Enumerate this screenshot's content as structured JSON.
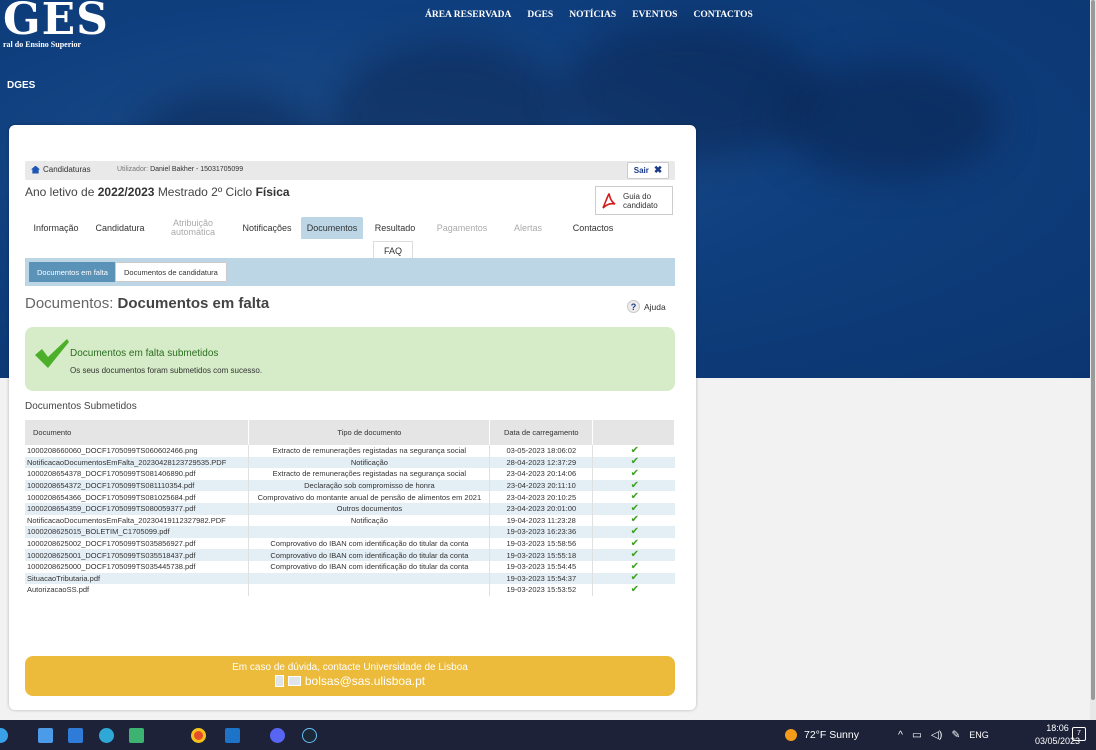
{
  "site": {
    "logo": "GES",
    "logo_sub": "ral do Ensino Superior",
    "section": "DGES",
    "nav": [
      "ÁREA RESERVADA",
      "DGES",
      "NOTÍCIAS",
      "EVENTOS",
      "CONTACTOS"
    ]
  },
  "userbar": {
    "home_label": "Candidaturas",
    "user_prefix": "Utilizador:",
    "user_name": "Daniel Bakher - 15031705099",
    "logout": "Sair"
  },
  "header": {
    "year_prefix": "Ano letivo de",
    "year": "2022/2023",
    "degree": "Mestrado 2º Ciclo",
    "course": "Física",
    "guide_line1": "Guia do",
    "guide_line2": "candidato"
  },
  "tabs": {
    "info": "Informação",
    "candidatura": "Candidatura",
    "atribuicao1": "Atribuição",
    "atribuicao2": "automática",
    "notificacoes": "Notificações",
    "documentos": "Documentos",
    "resultado": "Resultado",
    "pagamentos": "Pagamentos",
    "alertas": "Alertas",
    "contactos": "Contactos",
    "faq": "FAQ"
  },
  "subtabs": {
    "missing": "Documentos em falta",
    "application": "Documentos de candidatura"
  },
  "page": {
    "title_prefix": "Documentos:",
    "title": "Documentos em falta",
    "help": "Ajuda"
  },
  "success": {
    "title": "Documentos em falta submetidos",
    "message": "Os seus documentos foram submetidos com sucesso."
  },
  "submitted": {
    "heading": "Documentos Submetidos",
    "columns": [
      "Documento",
      "Tipo de documento",
      "Data de carregamento",
      ""
    ],
    "rows": [
      [
        "1000208660060_DOCF1705099TS060602466.png",
        "Extracto de remunerações registadas na segurança social",
        "03-05-2023 18:06:02"
      ],
      [
        "NotificacaoDocumentosEmFalta_20230428123729535.PDF",
        "Notificação",
        "28-04-2023 12:37:29"
      ],
      [
        "1000208654378_DOCF1705099TS081406890.pdf",
        "Extracto de remunerações registadas na segurança social",
        "23-04-2023 20:14:06"
      ],
      [
        "1000208654372_DOCF1705099TS081110354.pdf",
        "Declaração sob compromisso de honra",
        "23-04-2023 20:11:10"
      ],
      [
        "1000208654366_DOCF1705099TS081025684.pdf",
        "Comprovativo do montante anual de pensão de alimentos em 2021",
        "23-04-2023 20:10:25"
      ],
      [
        "1000208654359_DOCF1705099TS080059377.pdf",
        "Outros documentos",
        "23-04-2023 20:01:00"
      ],
      [
        "NotificacaoDocumentosEmFalta_20230419112327982.PDF",
        "Notificação",
        "19-04-2023 11:23:28"
      ],
      [
        "1000208625015_BOLETIM_C1705099.pdf",
        "",
        "19-03-2023 16:23:36"
      ],
      [
        "1000208625002_DOCF1705099TS035856927.pdf",
        "Comprovativo do IBAN com identificação do titular da conta",
        "19-03-2023 15:58:56"
      ],
      [
        "1000208625001_DOCF1705099TS035518437.pdf",
        "Comprovativo do IBAN com identificação do titular da conta",
        "19-03-2023 15:55:18"
      ],
      [
        "1000208625000_DOCF1705099TS035445738.pdf",
        "Comprovativo do IBAN com identificação do titular da conta",
        "19-03-2023 15:54:45"
      ],
      [
        "SituacaoTributaria.pdf",
        "",
        "19-03-2023 15:54:37"
      ],
      [
        "AutorizacaoSS.pdf",
        "",
        "19-03-2023 15:53:52"
      ]
    ]
  },
  "contact": {
    "line1": "Em caso de dúvida, contacte Universidade de Lisboa",
    "email": "bolsas@sas.ulisboa.pt"
  },
  "taskbar": {
    "weather": "72°F  Sunny",
    "lang": "ENG",
    "time": "18:06",
    "date": "03/05/2023",
    "notifications": "7"
  }
}
